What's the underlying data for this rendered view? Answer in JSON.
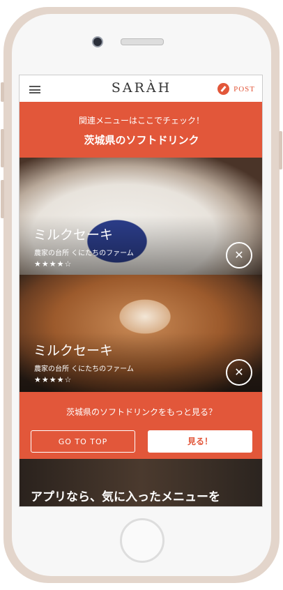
{
  "app": {
    "logo": "SARÀH",
    "post_label": "POST"
  },
  "header": {
    "subtitle": "関連メニューはここでチェック！",
    "title": "茨城県のソフトドリンク"
  },
  "cards": [
    {
      "name": "ミルクセーキ",
      "place": "農家の台所 くにたちのファーム",
      "stars": "★★★★☆"
    },
    {
      "name": "ミルクセーキ",
      "place": "農家の台所 くにたちのファーム",
      "stars": "★★★★☆"
    }
  ],
  "more": {
    "question": "茨城県のソフトドリンクをもっと見る？",
    "go_top": "GO TO TOP",
    "see": "見る！"
  },
  "promo": {
    "text": "アプリなら、気に入ったメニューを"
  },
  "icons": {
    "menu": "hamburger-icon",
    "post": "pencil-icon",
    "cutlery": "fork-knife-icon"
  },
  "colors": {
    "accent": "#e2573a"
  }
}
